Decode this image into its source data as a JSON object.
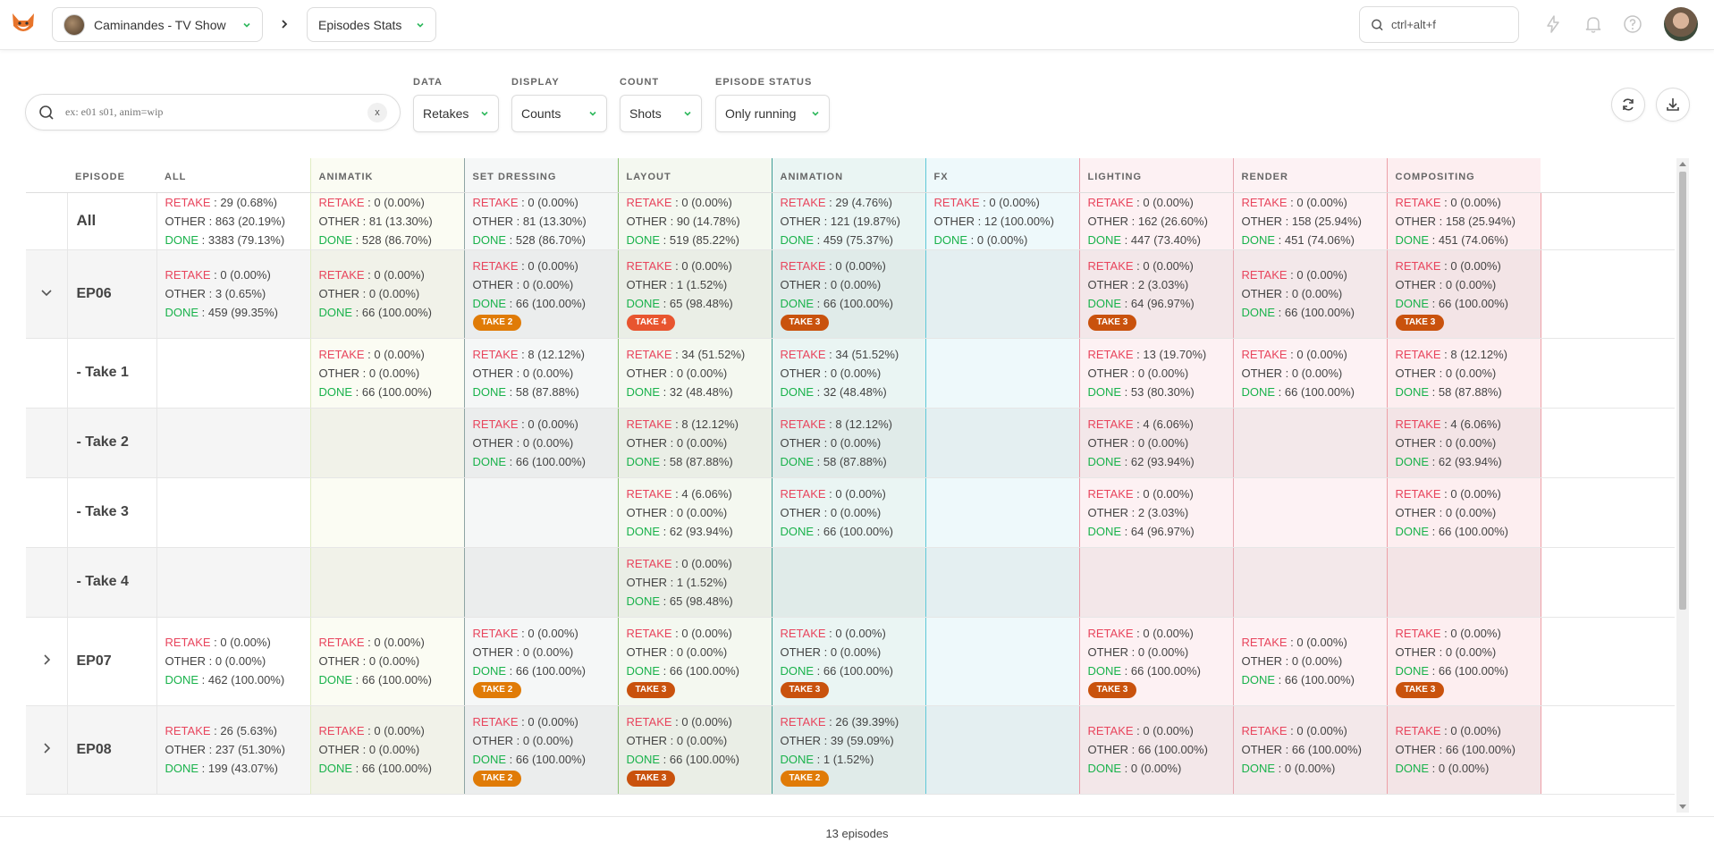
{
  "topbar": {
    "production": "Caminandes - TV Show",
    "section": "Episodes Stats",
    "search_value": "ctrl+alt+f"
  },
  "filters": {
    "search_placeholder": "ex: e01 s01, anim=wip",
    "clear_label": "x",
    "data_label": "DATA",
    "data_value": "Retakes",
    "display_label": "DISPLAY",
    "display_value": "Counts",
    "count_label": "COUNT",
    "count_value": "Shots",
    "status_label": "EPISODE STATUS",
    "status_value": "Only running"
  },
  "columns": [
    {
      "key": "episode",
      "label": "EPISODE",
      "bg": "#ffffff",
      "border": "#e6e6e6"
    },
    {
      "key": "all",
      "label": "ALL",
      "bg": "#ffffff",
      "border": "#e6e6e6"
    },
    {
      "key": "animatik",
      "label": "ANIMATIK",
      "bg": "#fbfcf3",
      "border": "#e0ecc2"
    },
    {
      "key": "set_dressing",
      "label": "SET DRESSING",
      "bg": "#f5f7f7",
      "border": "#8ea4a4"
    },
    {
      "key": "layout",
      "label": "LAYOUT",
      "bg": "#f4f8f0",
      "border": "#88c070"
    },
    {
      "key": "animation",
      "label": "ANIMATION",
      "bg": "#eaf5f3",
      "border": "#3f9c96"
    },
    {
      "key": "fx",
      "label": "FX",
      "bg": "#eef9fb",
      "border": "#5fc8d8"
    },
    {
      "key": "lighting",
      "label": "LIGHTING",
      "bg": "#fdf1f3",
      "border": "#eb9aa8"
    },
    {
      "key": "render",
      "label": "RENDER",
      "bg": "#fdf2f4",
      "border": "#e7a7b1"
    },
    {
      "key": "compositing",
      "label": "COMPOSITING",
      "bg": "#fdeef0",
      "border": "#eda0a8"
    }
  ],
  "rows": [
    {
      "name": "All",
      "expander": "",
      "height": 64,
      "cells": [
        {
          "retake": "29 (0.68%)",
          "other": "863 (20.19%)",
          "done": "3383 (79.13%)"
        },
        {
          "retake": "0 (0.00%)",
          "other": "81 (13.30%)",
          "done": "528 (86.70%)"
        },
        {
          "retake": "0 (0.00%)",
          "other": "81 (13.30%)",
          "done": "528 (86.70%)"
        },
        {
          "retake": "0 (0.00%)",
          "other": "90 (14.78%)",
          "done": "519 (85.22%)"
        },
        {
          "retake": "29 (4.76%)",
          "other": "121 (19.87%)",
          "done": "459 (75.37%)"
        },
        {
          "retake": "0 (0.00%)",
          "other": "12 (100.00%)",
          "done": "0 (0.00%)"
        },
        {
          "retake": "0 (0.00%)",
          "other": "162 (26.60%)",
          "done": "447 (73.40%)"
        },
        {
          "retake": "0 (0.00%)",
          "other": "158 (25.94%)",
          "done": "451 (74.06%)"
        },
        {
          "retake": "0 (0.00%)",
          "other": "158 (25.94%)",
          "done": "451 (74.06%)"
        }
      ]
    },
    {
      "name": "EP06",
      "expander": "down",
      "height": 99,
      "cells": [
        {
          "retake": "0 (0.00%)",
          "other": "3 (0.65%)",
          "done": "459 (99.35%)"
        },
        {
          "retake": "0 (0.00%)",
          "other": "0 (0.00%)",
          "done": "66 (100.00%)"
        },
        {
          "retake": "0 (0.00%)",
          "other": "0 (0.00%)",
          "done": "66 (100.00%)",
          "badge": "TAKE 2",
          "badge_color": "orange"
        },
        {
          "retake": "0 (0.00%)",
          "other": "1 (1.52%)",
          "done": "65 (98.48%)",
          "badge": "TAKE 4",
          "badge_color": "red"
        },
        {
          "retake": "0 (0.00%)",
          "other": "0 (0.00%)",
          "done": "66 (100.00%)",
          "badge": "TAKE 3",
          "badge_color": "brown"
        },
        null,
        {
          "retake": "0 (0.00%)",
          "other": "2 (3.03%)",
          "done": "64 (96.97%)",
          "badge": "TAKE 3",
          "badge_color": "brown"
        },
        {
          "retake": "0 (0.00%)",
          "other": "0 (0.00%)",
          "done": "66 (100.00%)"
        },
        {
          "retake": "0 (0.00%)",
          "other": "0 (0.00%)",
          "done": "66 (100.00%)",
          "badge": "TAKE 3",
          "badge_color": "brown"
        }
      ]
    },
    {
      "name": "- Take 1",
      "expander": "",
      "height": 78,
      "cells": [
        null,
        {
          "retake": "0 (0.00%)",
          "other": "0 (0.00%)",
          "done": "66 (100.00%)"
        },
        {
          "retake": "8 (12.12%)",
          "other": "0 (0.00%)",
          "done": "58 (87.88%)"
        },
        {
          "retake": "34 (51.52%)",
          "other": "0 (0.00%)",
          "done": "32 (48.48%)"
        },
        {
          "retake": "34 (51.52%)",
          "other": "0 (0.00%)",
          "done": "32 (48.48%)"
        },
        null,
        {
          "retake": "13 (19.70%)",
          "other": "0 (0.00%)",
          "done": "53 (80.30%)"
        },
        {
          "retake": "0 (0.00%)",
          "other": "0 (0.00%)",
          "done": "66 (100.00%)"
        },
        {
          "retake": "8 (12.12%)",
          "other": "0 (0.00%)",
          "done": "58 (87.88%)"
        }
      ]
    },
    {
      "name": "- Take 2",
      "expander": "",
      "height": 78,
      "cells": [
        null,
        null,
        {
          "retake": "0 (0.00%)",
          "other": "0 (0.00%)",
          "done": "66 (100.00%)"
        },
        {
          "retake": "8 (12.12%)",
          "other": "0 (0.00%)",
          "done": "58 (87.88%)"
        },
        {
          "retake": "8 (12.12%)",
          "other": "0 (0.00%)",
          "done": "58 (87.88%)"
        },
        null,
        {
          "retake": "4 (6.06%)",
          "other": "0 (0.00%)",
          "done": "62 (93.94%)"
        },
        null,
        {
          "retake": "4 (6.06%)",
          "other": "0 (0.00%)",
          "done": "62 (93.94%)"
        }
      ]
    },
    {
      "name": "- Take 3",
      "expander": "",
      "height": 78,
      "cells": [
        null,
        null,
        null,
        {
          "retake": "4 (6.06%)",
          "other": "0 (0.00%)",
          "done": "62 (93.94%)"
        },
        {
          "retake": "0 (0.00%)",
          "other": "0 (0.00%)",
          "done": "66 (100.00%)"
        },
        null,
        {
          "retake": "0 (0.00%)",
          "other": "2 (3.03%)",
          "done": "64 (96.97%)"
        },
        null,
        {
          "retake": "0 (0.00%)",
          "other": "0 (0.00%)",
          "done": "66 (100.00%)"
        }
      ]
    },
    {
      "name": "- Take 4",
      "expander": "",
      "height": 78,
      "cells": [
        null,
        null,
        null,
        {
          "retake": "0 (0.00%)",
          "other": "1 (1.52%)",
          "done": "65 (98.48%)"
        },
        null,
        null,
        null,
        null,
        null
      ]
    },
    {
      "name": "EP07",
      "expander": "right",
      "height": 99,
      "cells": [
        {
          "retake": "0 (0.00%)",
          "other": "0 (0.00%)",
          "done": "462 (100.00%)"
        },
        {
          "retake": "0 (0.00%)",
          "other": "0 (0.00%)",
          "done": "66 (100.00%)"
        },
        {
          "retake": "0 (0.00%)",
          "other": "0 (0.00%)",
          "done": "66 (100.00%)",
          "badge": "TAKE 2",
          "badge_color": "orange"
        },
        {
          "retake": "0 (0.00%)",
          "other": "0 (0.00%)",
          "done": "66 (100.00%)",
          "badge": "TAKE 3",
          "badge_color": "brown"
        },
        {
          "retake": "0 (0.00%)",
          "other": "0 (0.00%)",
          "done": "66 (100.00%)",
          "badge": "TAKE 3",
          "badge_color": "brown"
        },
        null,
        {
          "retake": "0 (0.00%)",
          "other": "0 (0.00%)",
          "done": "66 (100.00%)",
          "badge": "TAKE 3",
          "badge_color": "brown"
        },
        {
          "retake": "0 (0.00%)",
          "other": "0 (0.00%)",
          "done": "66 (100.00%)"
        },
        {
          "retake": "0 (0.00%)",
          "other": "0 (0.00%)",
          "done": "66 (100.00%)",
          "badge": "TAKE 3",
          "badge_color": "brown"
        }
      ]
    },
    {
      "name": "EP08",
      "expander": "right",
      "height": 99,
      "cells": [
        {
          "retake": "26 (5.63%)",
          "other": "237 (51.30%)",
          "done": "199 (43.07%)"
        },
        {
          "retake": "0 (0.00%)",
          "other": "0 (0.00%)",
          "done": "66 (100.00%)"
        },
        {
          "retake": "0 (0.00%)",
          "other": "0 (0.00%)",
          "done": "66 (100.00%)",
          "badge": "TAKE 2",
          "badge_color": "orange"
        },
        {
          "retake": "0 (0.00%)",
          "other": "0 (0.00%)",
          "done": "66 (100.00%)",
          "badge": "TAKE 3",
          "badge_color": "brown"
        },
        {
          "retake": "26 (39.39%)",
          "other": "39 (59.09%)",
          "done": "1 (1.52%)",
          "badge": "TAKE 2",
          "badge_color": "orange"
        },
        null,
        {
          "retake": "0 (0.00%)",
          "other": "66 (100.00%)",
          "done": "0 (0.00%)"
        },
        {
          "retake": "0 (0.00%)",
          "other": "66 (100.00%)",
          "done": "0 (0.00%)"
        },
        {
          "retake": "0 (0.00%)",
          "other": "66 (100.00%)",
          "done": "0 (0.00%)"
        }
      ]
    }
  ],
  "labels": {
    "retake": "RETAKE",
    "other": "OTHER",
    "done": "DONE"
  },
  "footer": {
    "count": "13 episodes"
  }
}
